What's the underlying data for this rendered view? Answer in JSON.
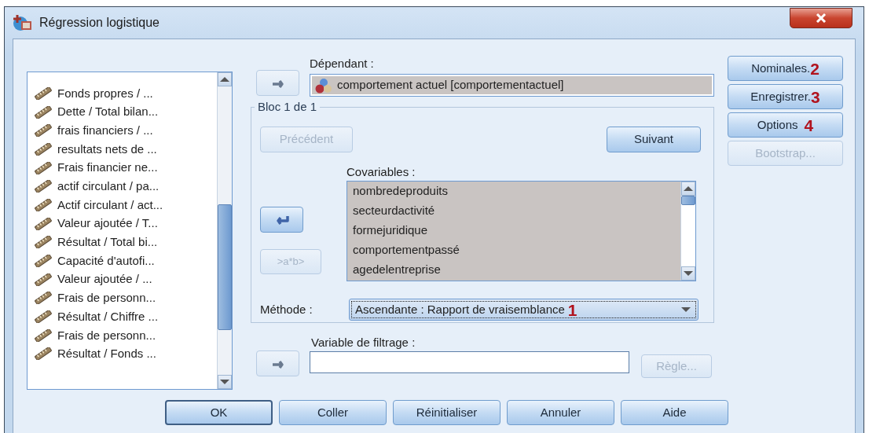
{
  "window": {
    "title": "Régression logistique"
  },
  "variables": [
    {
      "label": "Fonds propres / ..."
    },
    {
      "label": "Dette / Total bilan..."
    },
    {
      "label": "frais financiers / ..."
    },
    {
      "label": "resultats nets de ..."
    },
    {
      "label": "Frais financier ne..."
    },
    {
      "label": "actif circulant / pa..."
    },
    {
      "label": "Actif circulant / act..."
    },
    {
      "label": "Valeur ajoutée / T..."
    },
    {
      "label": "Résultat / Total bi..."
    },
    {
      "label": "Capacité d'autofi..."
    },
    {
      "label": "Valeur ajoutée / ..."
    },
    {
      "label": "Frais de personn..."
    },
    {
      "label": "Résultat / Chiffre ..."
    },
    {
      "label": "Frais de personn..."
    },
    {
      "label": "Résultat / Fonds ..."
    }
  ],
  "dependent": {
    "label": "Dépendant :",
    "value": "comportement actuel [comportementactuel]",
    "move_disabled": true
  },
  "block": {
    "title": "Bloc 1 de 1",
    "previous": {
      "label": "Précédent",
      "disabled": true
    },
    "next": {
      "label": "Suivant",
      "disabled": false
    }
  },
  "covariates": {
    "label": "Covariables :",
    "move_disabled": false,
    "items": [
      "nombredeproduits",
      "secteurdactivité",
      "formejuridique",
      "comportementpassé",
      "agedelentreprise"
    ]
  },
  "interaction_button": {
    "label": ">a*b>",
    "disabled": true
  },
  "method": {
    "label": "Méthode :",
    "value": "Ascendante : Rapport de vraisemblance",
    "annotation": "1"
  },
  "filter": {
    "label": "Variable de filtrage :",
    "move_disabled": true,
    "rule_button": {
      "label": "Règle...",
      "disabled": true
    }
  },
  "side_buttons": [
    {
      "label": "Nominales.",
      "annotation": "2",
      "disabled": false
    },
    {
      "label": "Enregistrer.",
      "annotation": "3",
      "disabled": false
    },
    {
      "label": "Options",
      "annotation": "4",
      "disabled": false
    },
    {
      "label": "Bootstrap...",
      "disabled": true
    }
  ],
  "footer_buttons": [
    {
      "label": "OK",
      "default": true
    },
    {
      "label": "Coller",
      "default": false
    },
    {
      "label": "Réinitialiser",
      "default": false
    },
    {
      "label": "Annuler",
      "default": false
    },
    {
      "label": "Aide",
      "default": false
    }
  ]
}
